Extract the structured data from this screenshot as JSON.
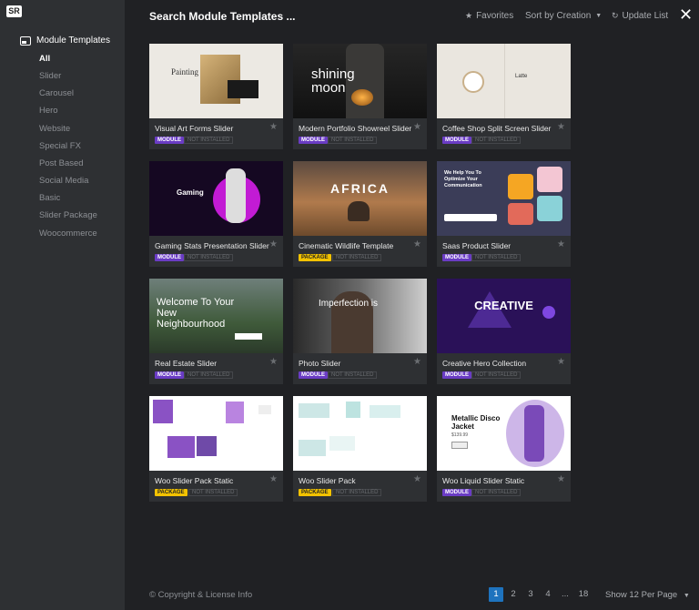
{
  "logo": "SR",
  "sidebar": {
    "heading": "Module Templates",
    "categories": [
      "All",
      "Slider",
      "Carousel",
      "Hero",
      "Website",
      "Special FX",
      "Post Based",
      "Social Media",
      "Basic",
      "Slider Package",
      "Woocommerce"
    ]
  },
  "header": {
    "title": "Search Module Templates ...",
    "favorites": "Favorites",
    "sort": "Sort by Creation",
    "update": "Update List"
  },
  "cards": [
    {
      "title": "Visual Art Forms Slider",
      "type": "MODULE",
      "status": "NOT INSTALLED",
      "thumb": "Painting"
    },
    {
      "title": "Modern Portfolio Showreel Slider",
      "type": "MODULE",
      "status": "NOT INSTALLED",
      "thumb": "shining moon"
    },
    {
      "title": "Coffee Shop Split Screen Slider",
      "type": "MODULE",
      "status": "NOT INSTALLED",
      "thumb": "Latte"
    },
    {
      "title": "Gaming Stats Presentation Slider",
      "type": "MODULE",
      "status": "NOT INSTALLED",
      "thumb": "Gaming"
    },
    {
      "title": "Cinematic Wildlife Template",
      "type": "PACKAGE",
      "status": "NOT INSTALLED",
      "thumb": "AFRICA"
    },
    {
      "title": "Saas Product Slider",
      "type": "MODULE",
      "status": "NOT INSTALLED",
      "thumb": "We Help You To Optimize Your Communication"
    },
    {
      "title": "Real Estate Slider",
      "type": "MODULE",
      "status": "NOT INSTALLED",
      "thumb": "Welcome To Your New Neighbourhood"
    },
    {
      "title": "Photo Slider",
      "type": "MODULE",
      "status": "NOT INSTALLED",
      "thumb": "Imperfection is"
    },
    {
      "title": "Creative Hero Collection",
      "type": "MODULE",
      "status": "NOT INSTALLED",
      "thumb": "CREATIVE"
    },
    {
      "title": "Woo Slider Pack Static",
      "type": "PACKAGE",
      "status": "NOT INSTALLED",
      "thumb": ""
    },
    {
      "title": "Woo Slider Pack",
      "type": "PACKAGE",
      "status": "NOT INSTALLED",
      "thumb": ""
    },
    {
      "title": "Woo Liquid Slider Static",
      "type": "MODULE",
      "status": "NOT INSTALLED",
      "thumb": "Metallic Disco Jacket"
    }
  ],
  "thumb_extra": {
    "price": "$139.99"
  },
  "footer": {
    "copyright": "© Copyright & License Info",
    "pages": [
      "1",
      "2",
      "3",
      "4",
      "...",
      "18"
    ],
    "per_page": "Show 12 Per Page"
  },
  "colors": {
    "accent": "#1e73be",
    "module": "#6a3cc4",
    "package": "#f2c200",
    "sidebar": "#2e3033",
    "background": "#202124"
  }
}
